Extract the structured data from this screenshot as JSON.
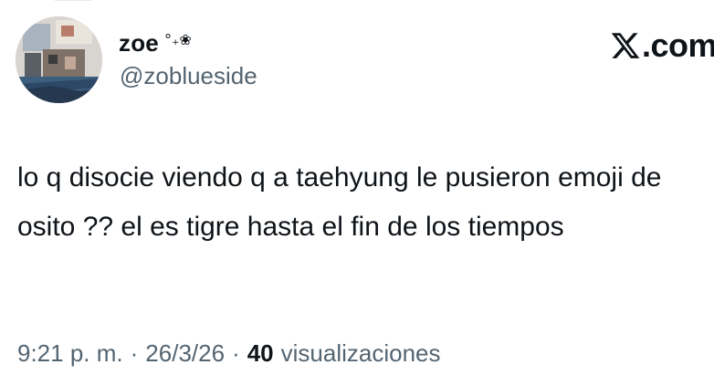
{
  "author": {
    "display_name": "zoe",
    "name_decoration": "°₊❀",
    "handle": "@zoblueside"
  },
  "brand": {
    "text": ".com",
    "logo_icon": "x-logo-icon"
  },
  "tweet": {
    "text": "lo q disocie viendo q a taehyung le pusieron emoji de osito ?? el es tigre hasta el fin de los tiempos"
  },
  "meta": {
    "time": "9:21 p. m.",
    "separator": "·",
    "date": "26/3/26",
    "views_count": "40",
    "views_label": "visualizaciones"
  }
}
